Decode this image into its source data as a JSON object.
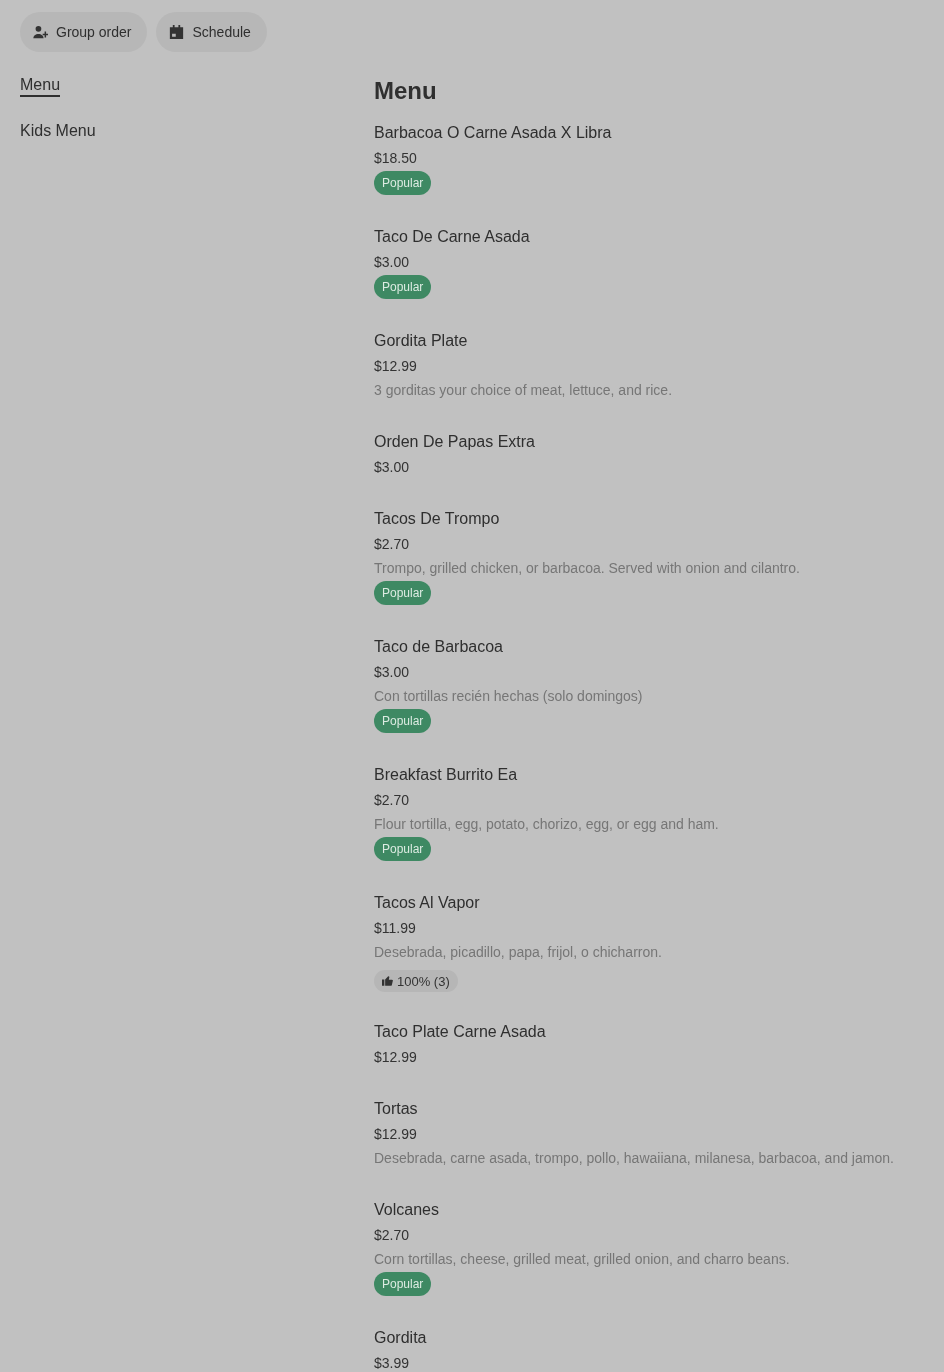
{
  "toolbar": {
    "buttons": [
      {
        "kind": "group",
        "label": "Group order"
      },
      {
        "kind": "schedule",
        "label": "Schedule"
      }
    ]
  },
  "sidebar": {
    "items": [
      {
        "label": "Menu",
        "selected": true
      },
      {
        "label": "Kids Menu",
        "selected": false
      }
    ]
  },
  "menu": {
    "title": "Menu",
    "items": [
      {
        "name": "Barbacoa O Carne Asada X Libra",
        "price": "$18.50",
        "badge": {
          "kind": "popular",
          "label": "Popular"
        }
      },
      {
        "name": "Taco De Carne Asada",
        "price": "$3.00",
        "badge": {
          "kind": "popular",
          "label": "Popular"
        }
      },
      {
        "name": "Gordita Plate",
        "price": "$12.99",
        "description": "3 gorditas your choice of meat, lettuce, and rice."
      },
      {
        "name": "Orden De Papas Extra",
        "price": "$3.00"
      },
      {
        "name": "Tacos De Trompo",
        "price": "$2.70",
        "description": "Trompo, grilled chicken, or barbacoa. Served with onion and cilantro.",
        "badge": {
          "kind": "popular",
          "label": "Popular"
        }
      },
      {
        "name": "Taco de Barbacoa",
        "price": "$3.00",
        "description": "Con tortillas recién hechas (solo domingos)",
        "badge": {
          "kind": "popular",
          "label": "Popular"
        }
      },
      {
        "name": "Breakfast Burrito Ea",
        "price": "$2.70",
        "description": "Flour tortilla, egg, potato, chorizo, egg, or egg and ham.",
        "badge": {
          "kind": "popular",
          "label": "Popular"
        }
      },
      {
        "name": "Tacos Al Vapor",
        "price": "$11.99",
        "description": "Desebrada, picadillo, papa, frijol, o chicharron.",
        "badge": {
          "kind": "rating",
          "label": "100% (3)"
        }
      },
      {
        "name": "Taco Plate Carne Asada",
        "price": "$12.99"
      },
      {
        "name": "Tortas",
        "price": "$12.99",
        "description": "Desebrada, carne asada, trompo, pollo, hawaiiana, milanesa, barbacoa, and jamon."
      },
      {
        "name": "Volcanes",
        "price": "$2.70",
        "description": "Corn tortillas, cheese, grilled meat, grilled onion, and charro beans.",
        "badge": {
          "kind": "popular",
          "label": "Popular"
        }
      },
      {
        "name": "Gordita",
        "price": "$3.99"
      }
    ]
  }
}
